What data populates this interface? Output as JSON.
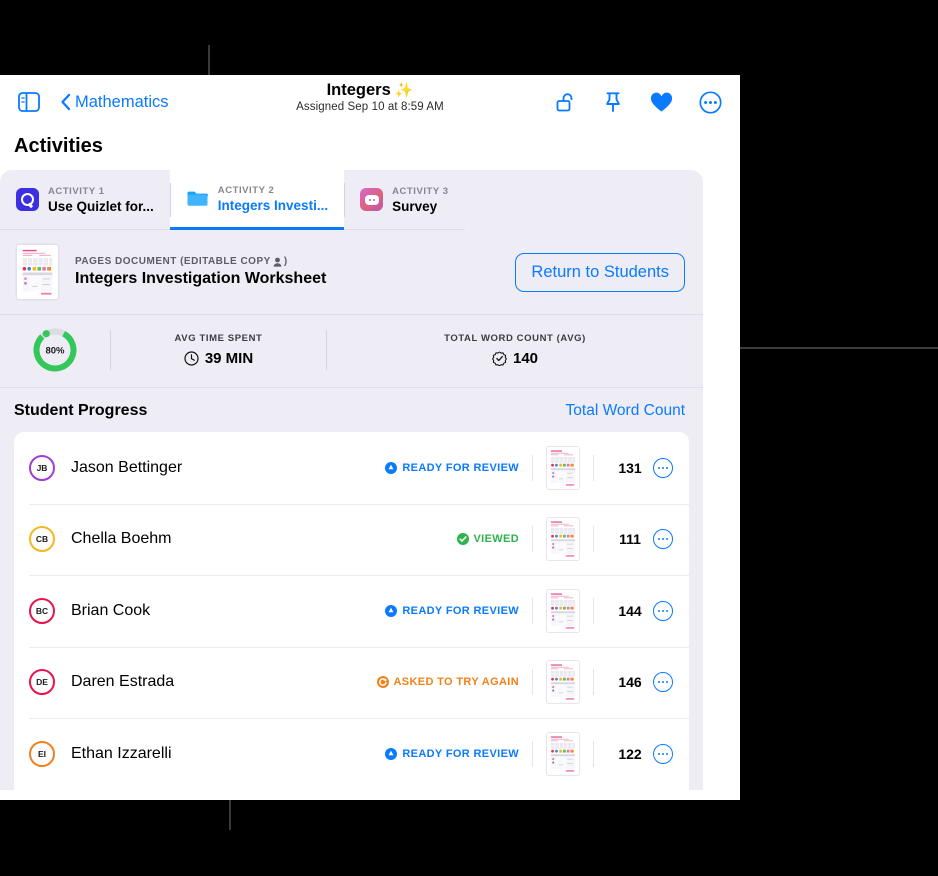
{
  "window": {
    "toolbar": {
      "sidebar_icon": "sidebar-icon",
      "back_icon": "chevron-left-icon",
      "back_label": "Mathematics",
      "title": "Integers",
      "title_sparkle": "✨",
      "subtitle": "Assigned Sep 10 at 8:59 AM",
      "actions": [
        {
          "name": "unlock-icon",
          "label": "Unlock"
        },
        {
          "name": "pin-icon",
          "label": "Pin"
        },
        {
          "name": "heart-icon",
          "label": "Favorite"
        },
        {
          "name": "more-circle-icon",
          "label": "More"
        }
      ]
    },
    "page_title": "Activities",
    "tabs": [
      {
        "kicker": "ACTIVITY 1",
        "name": "Use Quizlet for...",
        "icon": "quizlet-icon",
        "active": false
      },
      {
        "kicker": "ACTIVITY 2",
        "name": "Integers Investi...",
        "icon": "folder-icon",
        "active": true
      },
      {
        "kicker": "ACTIVITY 3",
        "name": "Survey",
        "icon": "survey-icon",
        "active": false
      }
    ],
    "document": {
      "kicker": "PAGES DOCUMENT (EDITABLE COPY",
      "kicker_icon": "person-icon",
      "kicker_close": ")",
      "name": "Integers Investigation Worksheet",
      "thumbnail": "worksheet-thumbnail",
      "return_button": "Return to Students"
    },
    "stats": {
      "progress_ring": {
        "percent_label": "80%",
        "percent_value": 80,
        "color": "#34c759",
        "track_color": "#dcdce2"
      },
      "items": [
        {
          "label": "AVG TIME SPENT",
          "value": "39 MIN",
          "icon": "clock-icon"
        },
        {
          "label": "TOTAL WORD COUNT (AVG)",
          "value": "140",
          "icon": "checkmark-seal-icon"
        }
      ]
    },
    "student_progress": {
      "title": "Student Progress",
      "link": "Total Word Count",
      "rows": [
        {
          "initials": "JB",
          "ring": "#a13dd6",
          "name": "Jason Bettinger",
          "status": "READY FOR REVIEW",
          "status_type": "ready",
          "status_color": "#0a7aff",
          "word_count": "131"
        },
        {
          "initials": "CB",
          "ring": "#f5b81c",
          "name": "Chella Boehm",
          "status": "VIEWED",
          "status_type": "viewed",
          "status_color": "#2fb34a",
          "word_count": "111"
        },
        {
          "initials": "BC",
          "ring": "#e8134f",
          "name": "Brian Cook",
          "status": "READY FOR REVIEW",
          "status_type": "ready",
          "status_color": "#0a7aff",
          "word_count": "144"
        },
        {
          "initials": "DE",
          "ring": "#e8134f",
          "name": "Daren Estrada",
          "status": "ASKED TO TRY AGAIN",
          "status_type": "retry",
          "status_color": "#f28117",
          "word_count": "146"
        },
        {
          "initials": "EI",
          "ring": "#f0821e",
          "name": "Ethan Izzarelli",
          "status": "READY FOR REVIEW",
          "status_type": "ready",
          "status_color": "#0a7aff",
          "word_count": "122"
        }
      ],
      "row_more_icon": "more-circle-icon",
      "row_thumb_icon": "worksheet-thumbnail"
    }
  },
  "annotations": {
    "leader_lines": [
      {
        "name": "callout-line-activity-tab",
        "orientation": "vertical"
      },
      {
        "name": "callout-line-avg-time",
        "orientation": "vertical"
      },
      {
        "name": "callout-line-word-count",
        "orientation": "horizontal"
      }
    ]
  },
  "colors": {
    "accent_blue": "#0a7aff",
    "green": "#34c759",
    "orange": "#f28117",
    "card_bg": "#eeedf6",
    "page_bg": "#000000"
  }
}
